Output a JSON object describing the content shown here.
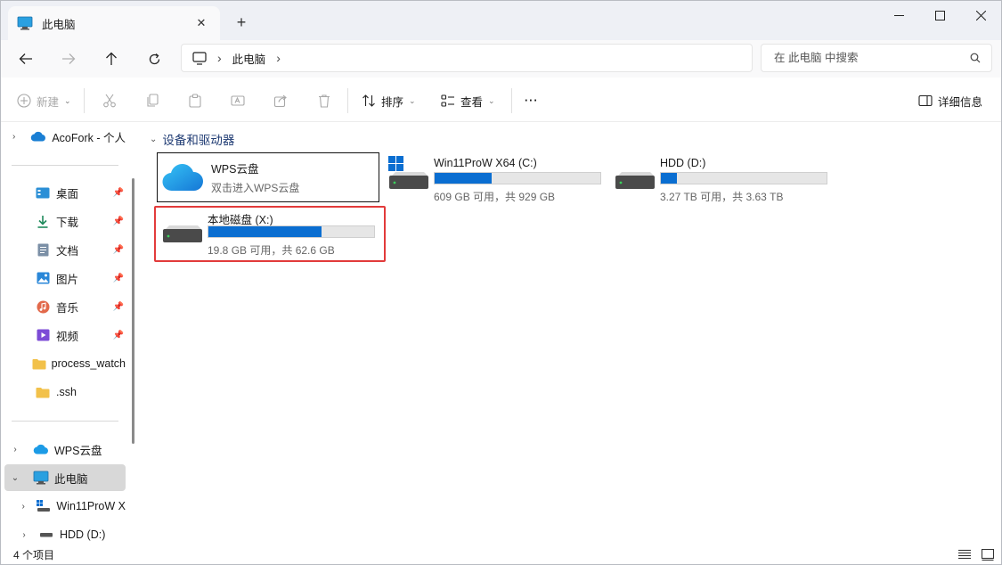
{
  "window": {
    "tab_title": "此电脑",
    "tab_close": "✕",
    "new_tab": "+"
  },
  "address": {
    "location": "此电脑"
  },
  "search": {
    "placeholder": "在 此电脑 中搜索"
  },
  "commands": {
    "new": "新建",
    "sort": "排序",
    "view": "查看",
    "more": "···",
    "details": "详细信息"
  },
  "sidebar": {
    "items": [
      {
        "label": "AcoFork - 个人"
      },
      {
        "label": "桌面"
      },
      {
        "label": "下载"
      },
      {
        "label": "文档"
      },
      {
        "label": "图片"
      },
      {
        "label": "音乐"
      },
      {
        "label": "视频"
      },
      {
        "label": "process_watch"
      },
      {
        "label": ".ssh"
      },
      {
        "label": "WPS云盘"
      },
      {
        "label": "此电脑"
      },
      {
        "label": "Win11ProW X"
      },
      {
        "label": "HDD (D:)"
      }
    ]
  },
  "main": {
    "group_title": "设备和驱动器",
    "wps": {
      "name": "WPS云盘",
      "subtitle": "双击进入WPS云盘"
    },
    "drives": [
      {
        "name": "Win11ProW X64 (C:)",
        "info": "609 GB 可用，共 929 GB",
        "used_fraction": 0.345
      },
      {
        "name": "HDD (D:)",
        "info": "3.27 TB 可用，共 3.63 TB",
        "used_fraction": 0.099
      },
      {
        "name": "本地磁盘 (X:)",
        "info": "19.8 GB 可用，共 62.6 GB",
        "used_fraction": 0.684
      }
    ]
  },
  "status": {
    "count": "4 个项目"
  },
  "colors": {
    "accent": "#0a6ed1",
    "highlight": "#e23b3b"
  }
}
